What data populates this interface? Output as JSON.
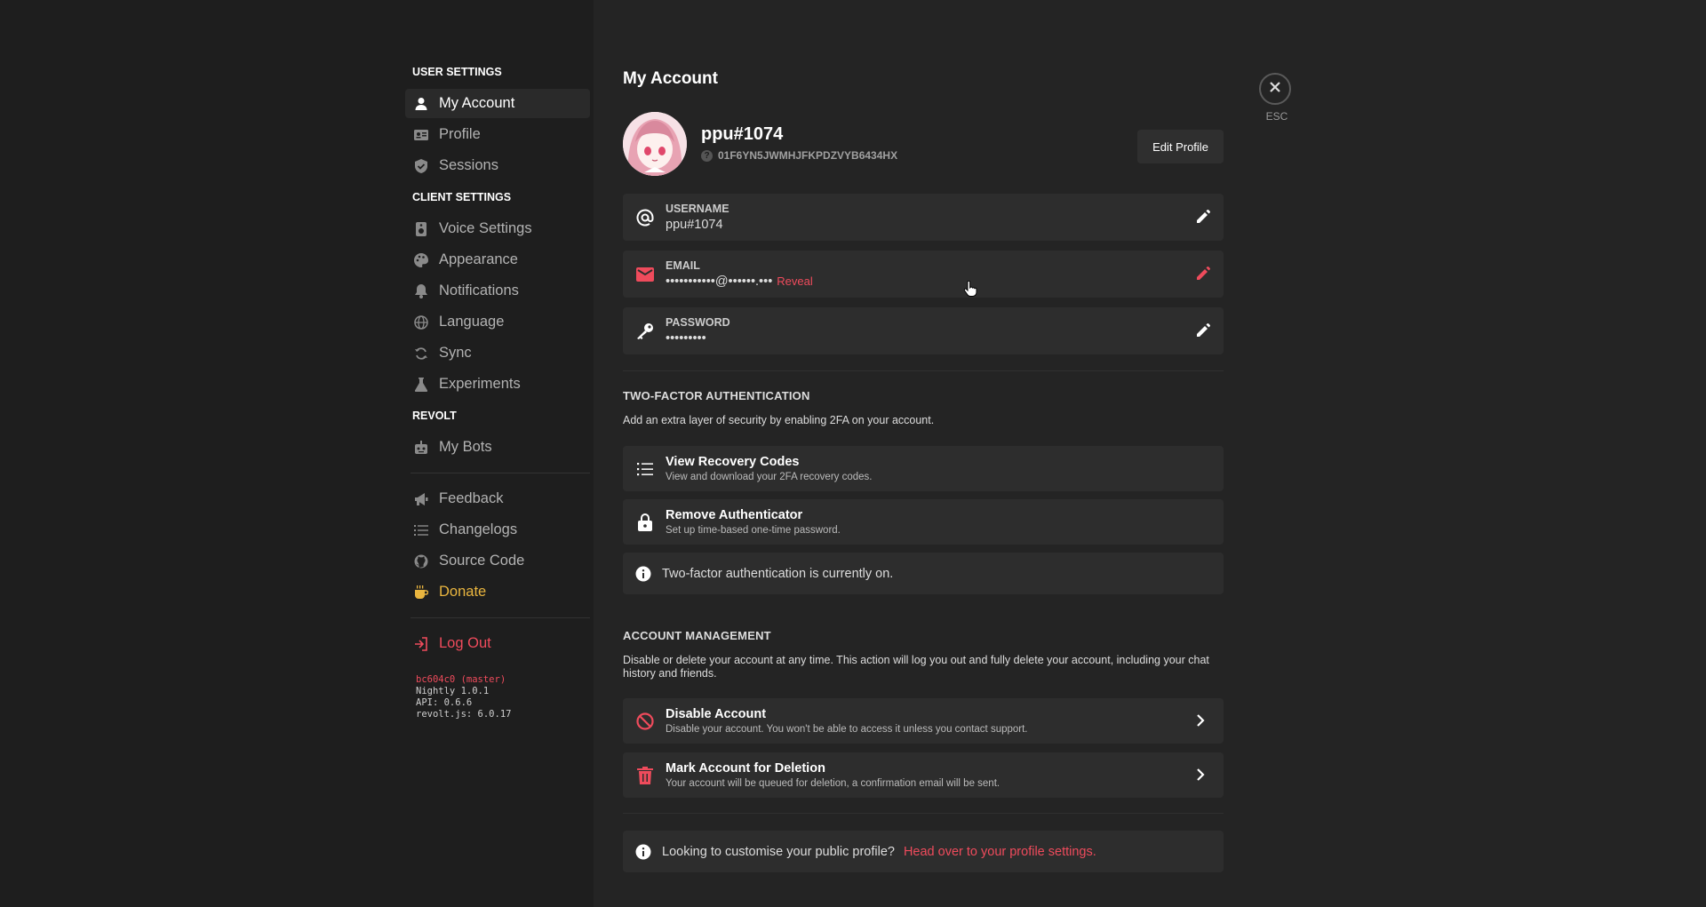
{
  "sidebar": {
    "user_settings_label": "USER SETTINGS",
    "client_settings_label": "CLIENT SETTINGS",
    "revolt_label": "REVOLT",
    "items": {
      "my_account": "My Account",
      "profile": "Profile",
      "sessions": "Sessions",
      "voice": "Voice Settings",
      "appearance": "Appearance",
      "notifications": "Notifications",
      "language": "Language",
      "sync": "Sync",
      "experiments": "Experiments",
      "my_bots": "My Bots",
      "feedback": "Feedback",
      "changelogs": "Changelogs",
      "source_code": "Source Code",
      "donate": "Donate",
      "log_out": "Log Out"
    },
    "version": {
      "commit": "bc604c0 (master)",
      "nightly": "Nightly 1.0.1",
      "api": "API: 0.6.6",
      "revoltjs": "revolt.js: 6.0.17"
    }
  },
  "header": {
    "title": "My Account",
    "esc_label": "ESC"
  },
  "profile": {
    "username": "ppu#1074",
    "user_id": "01F6YN5JWMHJFKPDZVYB6434HX",
    "edit_label": "Edit Profile"
  },
  "fields": {
    "username_label": "USERNAME",
    "username_value": "ppu#1074",
    "email_label": "EMAIL",
    "email_value": "•••••••••••@••••••.•••",
    "reveal_label": "Reveal",
    "password_label": "PASSWORD",
    "password_value": "•••••••••"
  },
  "two_factor": {
    "title": "TWO-FACTOR AUTHENTICATION",
    "description": "Add an extra layer of security by enabling 2FA on your account.",
    "recovery_title": "View Recovery Codes",
    "recovery_sub": "View and download your 2FA recovery codes.",
    "remove_title": "Remove Authenticator",
    "remove_sub": "Set up time-based one-time password.",
    "status": "Two-factor authentication is currently on."
  },
  "account_management": {
    "title": "ACCOUNT MANAGEMENT",
    "description": "Disable or delete your account at any time. This action will log you out and fully delete your account, including your chat history and friends.",
    "disable_title": "Disable Account",
    "disable_sub": "Disable your account. You won't be able to access it unless you contact support.",
    "delete_title": "Mark Account for Deletion",
    "delete_sub": "Your account will be queued for deletion, a confirmation email will be sent."
  },
  "footer_info": {
    "text": "Looking to customise your public profile?",
    "link": "Head over to your profile settings."
  },
  "colors": {
    "accent": "#ef4b5c",
    "donate": "#e9b53f"
  }
}
